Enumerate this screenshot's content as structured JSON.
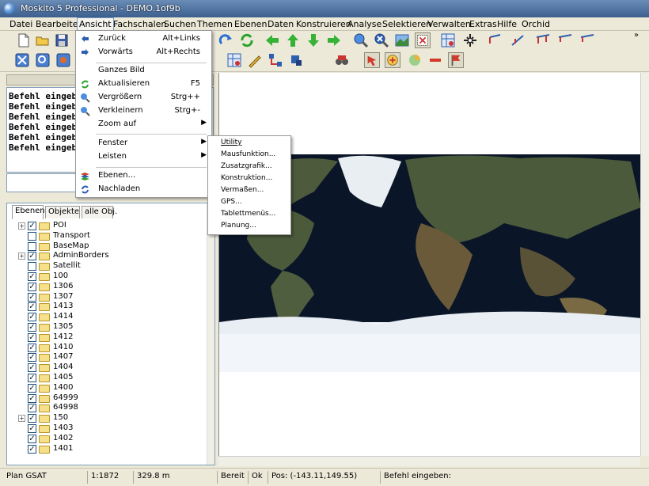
{
  "window": {
    "title": "Moskito 5 Professional - DEMO.1of9b"
  },
  "menubar": [
    "Datei",
    "Bearbeiten",
    "Ansicht",
    "Fachschalen",
    "Suchen",
    "Themen",
    "Ebenen",
    "Daten",
    "Konstruieren",
    "Analyse",
    "Selektieren",
    "Verwalten",
    "Extras",
    "Hilfe",
    "Orchid"
  ],
  "view_menu": {
    "items": [
      {
        "icon": "back-icon",
        "label": "Zurück",
        "shortcut": "Alt+Links"
      },
      {
        "icon": "forward-icon",
        "label": "Vorwärts",
        "shortcut": "Alt+Rechts"
      },
      {
        "icon": "",
        "label": "Ganzes Bild",
        "shortcut": ""
      },
      {
        "icon": "refresh-icon",
        "label": "Aktualisieren",
        "shortcut": "F5"
      },
      {
        "icon": "zoom-in-icon",
        "label": "Vergrößern",
        "shortcut": "Strg++"
      },
      {
        "icon": "zoom-out-icon",
        "label": "Verkleinern",
        "shortcut": "Strg+-"
      },
      {
        "icon": "",
        "label": "Zoom auf",
        "shortcut": ""
      },
      {
        "icon": "",
        "label": "Fenster",
        "shortcut": ""
      },
      {
        "icon": "",
        "label": "Leisten",
        "shortcut": ""
      },
      {
        "icon": "layers-icon",
        "label": "Ebenen...",
        "shortcut": ""
      },
      {
        "icon": "reload-icon",
        "label": "Nachladen",
        "shortcut": ""
      }
    ]
  },
  "window_submenu": [
    "Utility",
    "Mausfunktion...",
    "Zusatzgrafik...",
    "Konstruktion...",
    "Vermaßen...",
    "GPS...",
    "Tablettmenüs...",
    "Planung..."
  ],
  "command_log": [
    "Befehl eingebe",
    "Befehl eingebe",
    "Befehl eingebe",
    "Befehl eingebe",
    "Befehl eingebe",
    "Befehl eingebe"
  ],
  "tree_tabs": [
    "Ebenen",
    "Objekte",
    "alle Obj."
  ],
  "layers": [
    {
      "label": "POI",
      "expandable": true,
      "checked": true
    },
    {
      "label": "Transport",
      "expandable": false,
      "checked": false
    },
    {
      "label": "BaseMap",
      "expandable": false,
      "checked": false
    },
    {
      "label": "AdminBorders",
      "expandable": true,
      "checked": true
    },
    {
      "label": "Satellit",
      "expandable": false,
      "checked": false
    },
    {
      "label": "100",
      "expandable": false,
      "checked": true
    },
    {
      "label": "1306",
      "expandable": false,
      "checked": true
    },
    {
      "label": "1307",
      "expandable": false,
      "checked": true
    },
    {
      "label": "1413",
      "expandable": false,
      "checked": true
    },
    {
      "label": "1414",
      "expandable": false,
      "checked": true
    },
    {
      "label": "1305",
      "expandable": false,
      "checked": true
    },
    {
      "label": "1412",
      "expandable": false,
      "checked": true
    },
    {
      "label": "1410",
      "expandable": false,
      "checked": true
    },
    {
      "label": "1407",
      "expandable": false,
      "checked": true
    },
    {
      "label": "1404",
      "expandable": false,
      "checked": true
    },
    {
      "label": "1405",
      "expandable": false,
      "checked": true
    },
    {
      "label": "1400",
      "expandable": false,
      "checked": true
    },
    {
      "label": "64999",
      "expandable": false,
      "checked": true
    },
    {
      "label": "64998",
      "expandable": false,
      "checked": true
    },
    {
      "label": "150",
      "expandable": true,
      "checked": true
    },
    {
      "label": "1403",
      "expandable": false,
      "checked": true
    },
    {
      "label": "1402",
      "expandable": false,
      "checked": true
    },
    {
      "label": "1401",
      "expandable": false,
      "checked": true
    }
  ],
  "status": {
    "plan": "Plan GSAT",
    "scale": "1:1872",
    "distance": "329.8 m",
    "state": "Bereit",
    "ok": "Ok",
    "pos": "Pos: (-143.11,149.55)",
    "prompt": "Befehl eingeben:"
  },
  "colors": {
    "ocean": "#0a1628",
    "ice": "#f2f6fa",
    "land": "#4a5a3a"
  }
}
